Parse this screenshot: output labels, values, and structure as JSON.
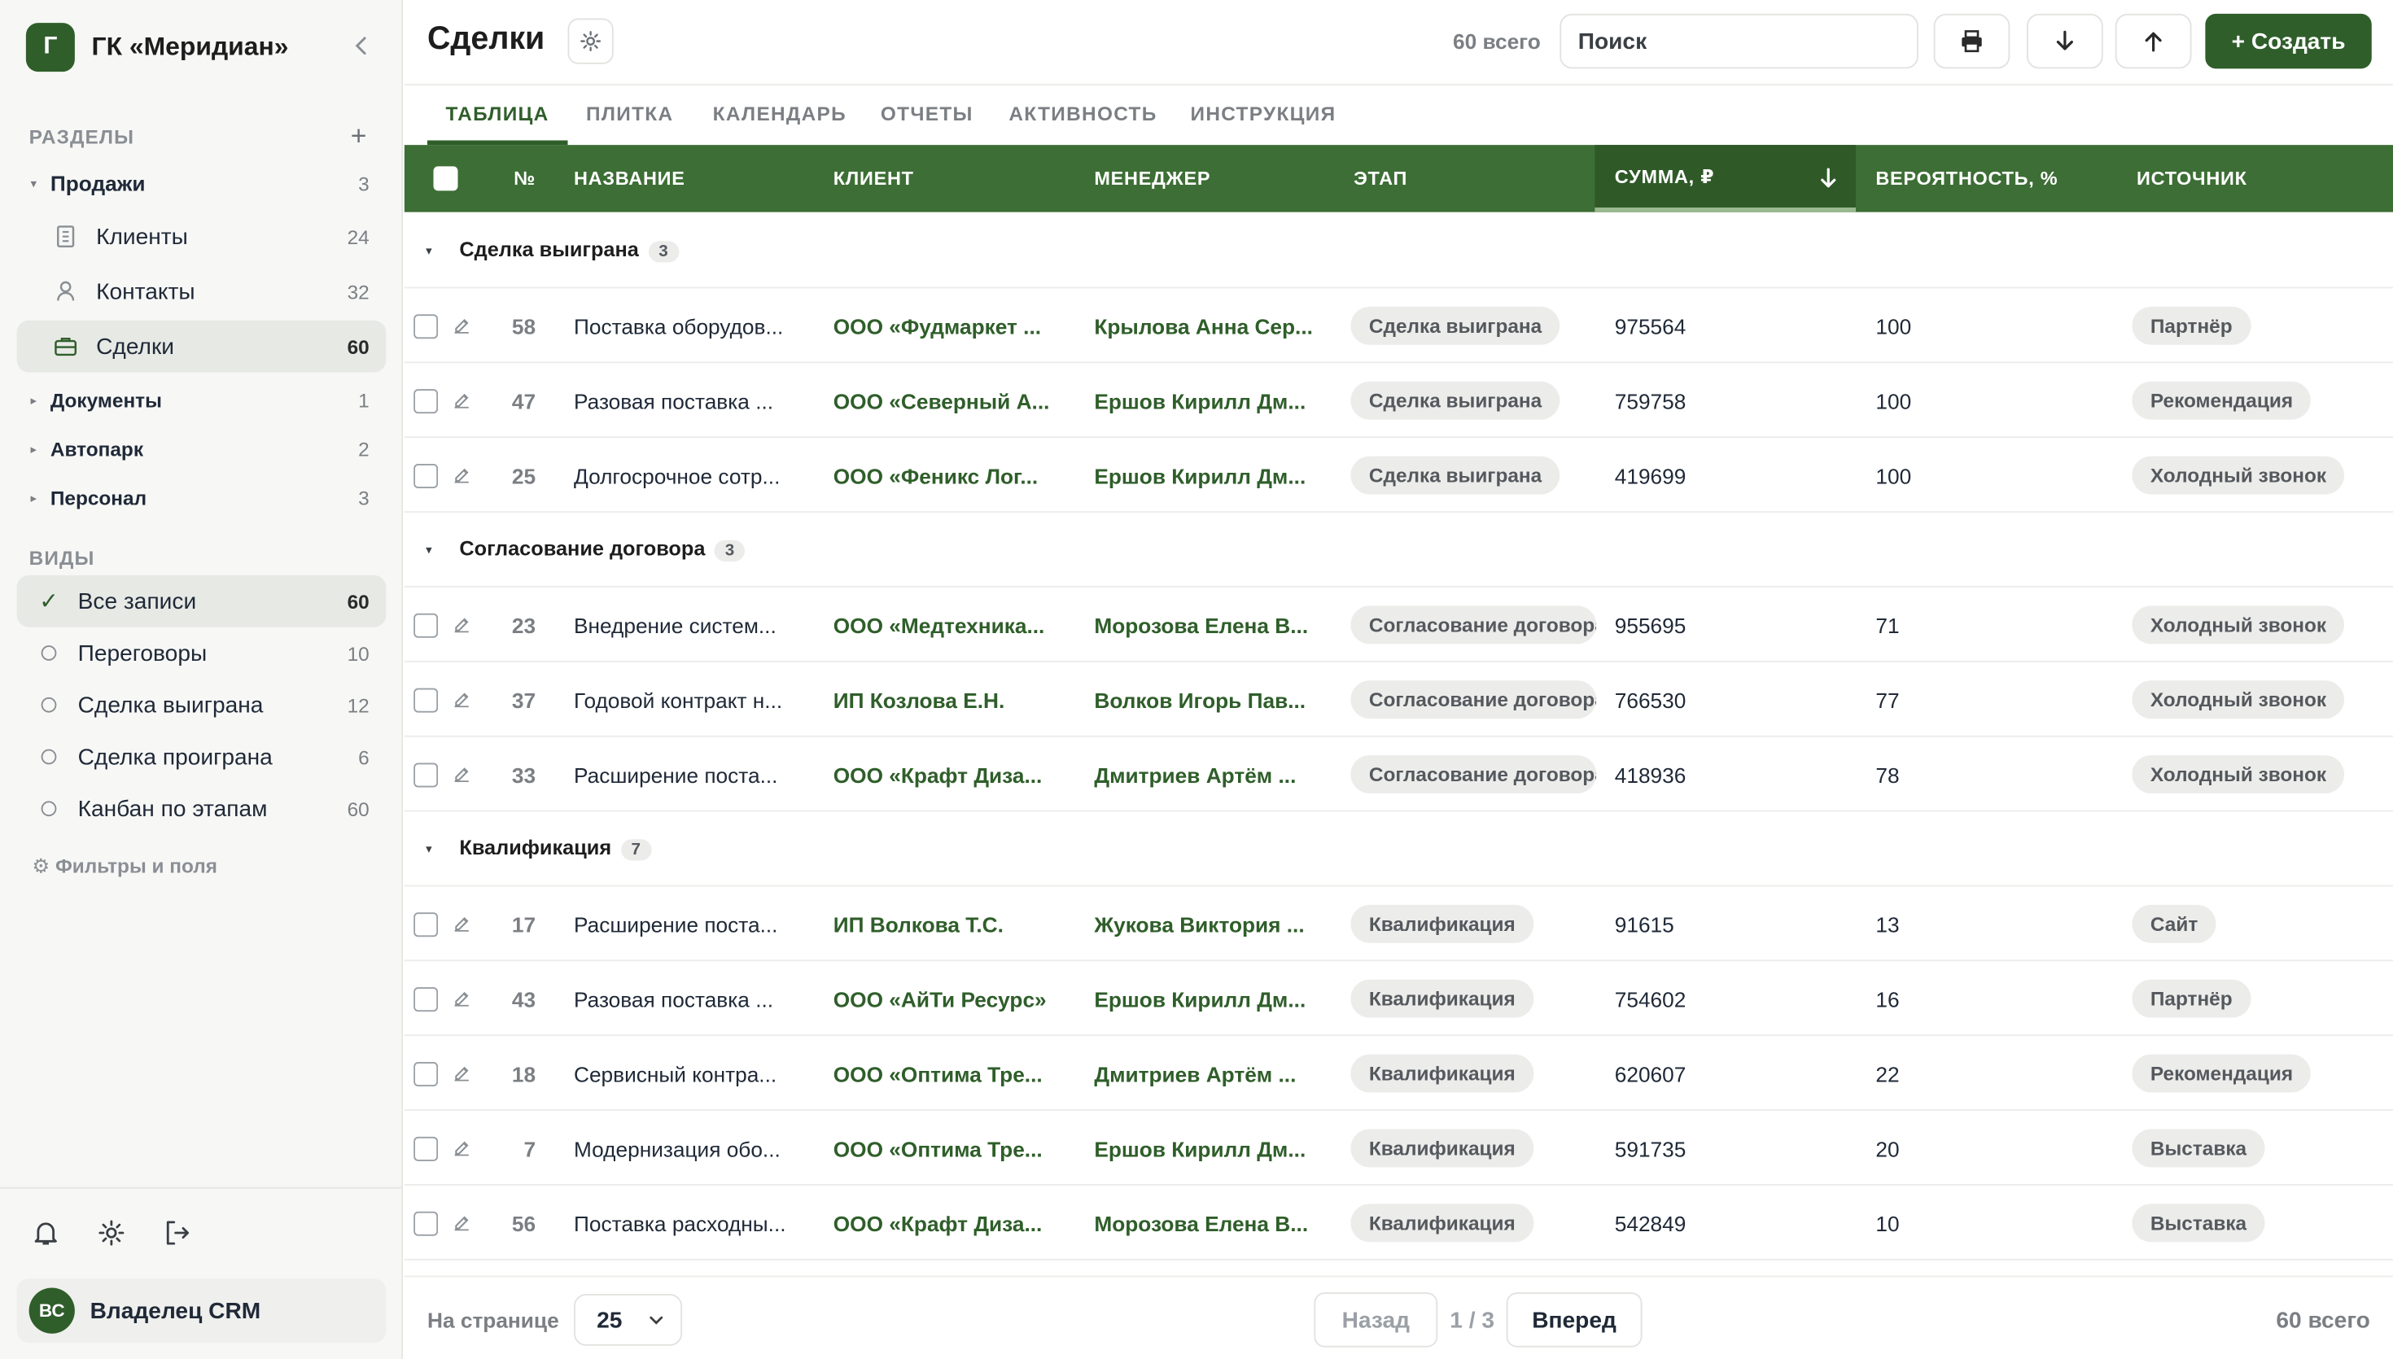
{
  "org": {
    "logo_letter": "Г",
    "name": "ГК «Меридиан»"
  },
  "sidebar": {
    "sections_title": "РАЗДЕЛЫ",
    "groups": [
      {
        "label": "Продажи",
        "count": "3"
      },
      {
        "label": "Документы",
        "count": "1"
      },
      {
        "label": "Автопарк",
        "count": "2"
      },
      {
        "label": "Персонал",
        "count": "3"
      }
    ],
    "sales_items": [
      {
        "label": "Клиенты",
        "count": "24",
        "icon": "building-icon"
      },
      {
        "label": "Контакты",
        "count": "32",
        "icon": "person-icon"
      },
      {
        "label": "Сделки",
        "count": "60",
        "icon": "briefcase-icon"
      }
    ],
    "views_title": "ВИДЫ",
    "views": [
      {
        "label": "Все записи",
        "count": "60"
      },
      {
        "label": "Переговоры",
        "count": "10"
      },
      {
        "label": "Сделка выиграна",
        "count": "12"
      },
      {
        "label": "Сделка проиграна",
        "count": "6"
      },
      {
        "label": "Канбан по этапам",
        "count": "60"
      }
    ],
    "filters_label": "⚙ Фильтры и поля",
    "user": {
      "initials": "ВС",
      "name": "Владелец CRM"
    }
  },
  "header": {
    "title": "Сделки",
    "total": "60 всего",
    "search_placeholder": "Поиск",
    "create_label": "+ Создать"
  },
  "tabs": [
    "ТАБЛИЦА",
    "ПЛИТКА",
    "КАЛЕНДАРЬ",
    "ОТЧЕТЫ",
    "АКТИВНОСТЬ",
    "ИНСТРУКЦИЯ"
  ],
  "columns": [
    "№",
    "НАЗВАНИЕ",
    "КЛИЕНТ",
    "МЕНЕДЖЕР",
    "ЭТАП",
    "СУММА, ₽",
    "ВЕРОЯТНОСТЬ, %",
    "ИСТОЧНИК"
  ],
  "groups": [
    {
      "title": "Сделка выиграна",
      "count": "3",
      "rows": [
        {
          "num": "58",
          "name": "Поставка оборудов...",
          "client": "ООО «Фудмаркет ...",
          "manager": "Крылова Анна Сер...",
          "stage": "Сделка выиграна",
          "sum": "975564",
          "prob": "100",
          "source": "Партнёр"
        },
        {
          "num": "47",
          "name": "Разовая поставка ...",
          "client": "ООО «Северный А...",
          "manager": "Ершов Кирилл Дм...",
          "stage": "Сделка выиграна",
          "sum": "759758",
          "prob": "100",
          "source": "Рекомендация"
        },
        {
          "num": "25",
          "name": "Долгосрочное сотр...",
          "client": "ООО «Феникс Лог...",
          "manager": "Ершов Кирилл Дм...",
          "stage": "Сделка выиграна",
          "sum": "419699",
          "prob": "100",
          "source": "Холодный звонок"
        }
      ]
    },
    {
      "title": "Согласование договора",
      "count": "3",
      "rows": [
        {
          "num": "23",
          "name": "Внедрение систем...",
          "client": "ООО «Медтехника...",
          "manager": "Морозова Елена В...",
          "stage": "Согласование договора",
          "sum": "955695",
          "prob": "71",
          "source": "Холодный звонок"
        },
        {
          "num": "37",
          "name": "Годовой контракт н...",
          "client": "ИП Козлова Е.Н.",
          "manager": "Волков Игорь Пав...",
          "stage": "Согласование договора",
          "sum": "766530",
          "prob": "77",
          "source": "Холодный звонок"
        },
        {
          "num": "33",
          "name": "Расширение поста...",
          "client": "ООО «Крафт Диза...",
          "manager": "Дмитриев Артём ...",
          "stage": "Согласование договора",
          "sum": "418936",
          "prob": "78",
          "source": "Холодный звонок"
        }
      ]
    },
    {
      "title": "Квалификация",
      "count": "7",
      "rows": [
        {
          "num": "17",
          "name": "Расширение поста...",
          "client": "ИП Волкова Т.С.",
          "manager": "Жукова Виктория ...",
          "stage": "Квалификация",
          "sum": "91615",
          "prob": "13",
          "source": "Сайт"
        },
        {
          "num": "43",
          "name": "Разовая поставка ...",
          "client": "ООО «АйТи Ресурс»",
          "manager": "Ершов Кирилл Дм...",
          "stage": "Квалификация",
          "sum": "754602",
          "prob": "16",
          "source": "Партнёр"
        },
        {
          "num": "18",
          "name": "Сервисный контра...",
          "client": "ООО «Оптима Тре...",
          "manager": "Дмитриев Артём ...",
          "stage": "Квалификация",
          "sum": "620607",
          "prob": "22",
          "source": "Рекомендация"
        },
        {
          "num": "7",
          "name": "Модернизация обо...",
          "client": "ООО «Оптима Тре...",
          "manager": "Ершов Кирилл Дм...",
          "stage": "Квалификация",
          "sum": "591735",
          "prob": "20",
          "source": "Выставка"
        },
        {
          "num": "56",
          "name": "Поставка расходны...",
          "client": "ООО «Крафт Диза...",
          "manager": "Морозова Елена В...",
          "stage": "Квалификация",
          "sum": "542849",
          "prob": "10",
          "source": "Выставка"
        }
      ]
    }
  ],
  "footer": {
    "per_page_label": "На странице",
    "per_page_value": "25",
    "back_label": "Назад",
    "page_indicator": "1 / 3",
    "next_label": "Вперед",
    "total": "60 всего"
  },
  "colors": {
    "accent": "#2f5e2a",
    "header": "#3d6e35",
    "sorted_header": "#2f5a28"
  }
}
